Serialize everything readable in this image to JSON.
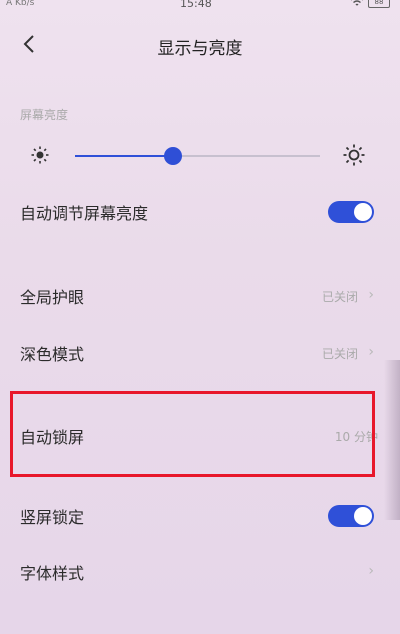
{
  "status_bar": {
    "time": "15:48",
    "carrier": "A Kb/s",
    "battery": "88"
  },
  "header": {
    "title": "显示与亮度"
  },
  "brightness": {
    "section_label": "屏幕亮度",
    "level_percent": 40
  },
  "settings": {
    "auto_brightness": {
      "label": "自动调节屏幕亮度",
      "enabled": true
    },
    "eye_care": {
      "label": "全局护眼",
      "value": "已关闭"
    },
    "dark_mode": {
      "label": "深色模式",
      "value": "已关闭"
    },
    "auto_lock": {
      "label": "自动锁屏",
      "value": "10 分钟"
    },
    "portrait_lock": {
      "label": "竖屏锁定",
      "enabled": true
    },
    "font_style": {
      "label": "字体样式"
    }
  },
  "colors": {
    "accent": "#2f50d8",
    "highlight_border": "#e8172b"
  }
}
